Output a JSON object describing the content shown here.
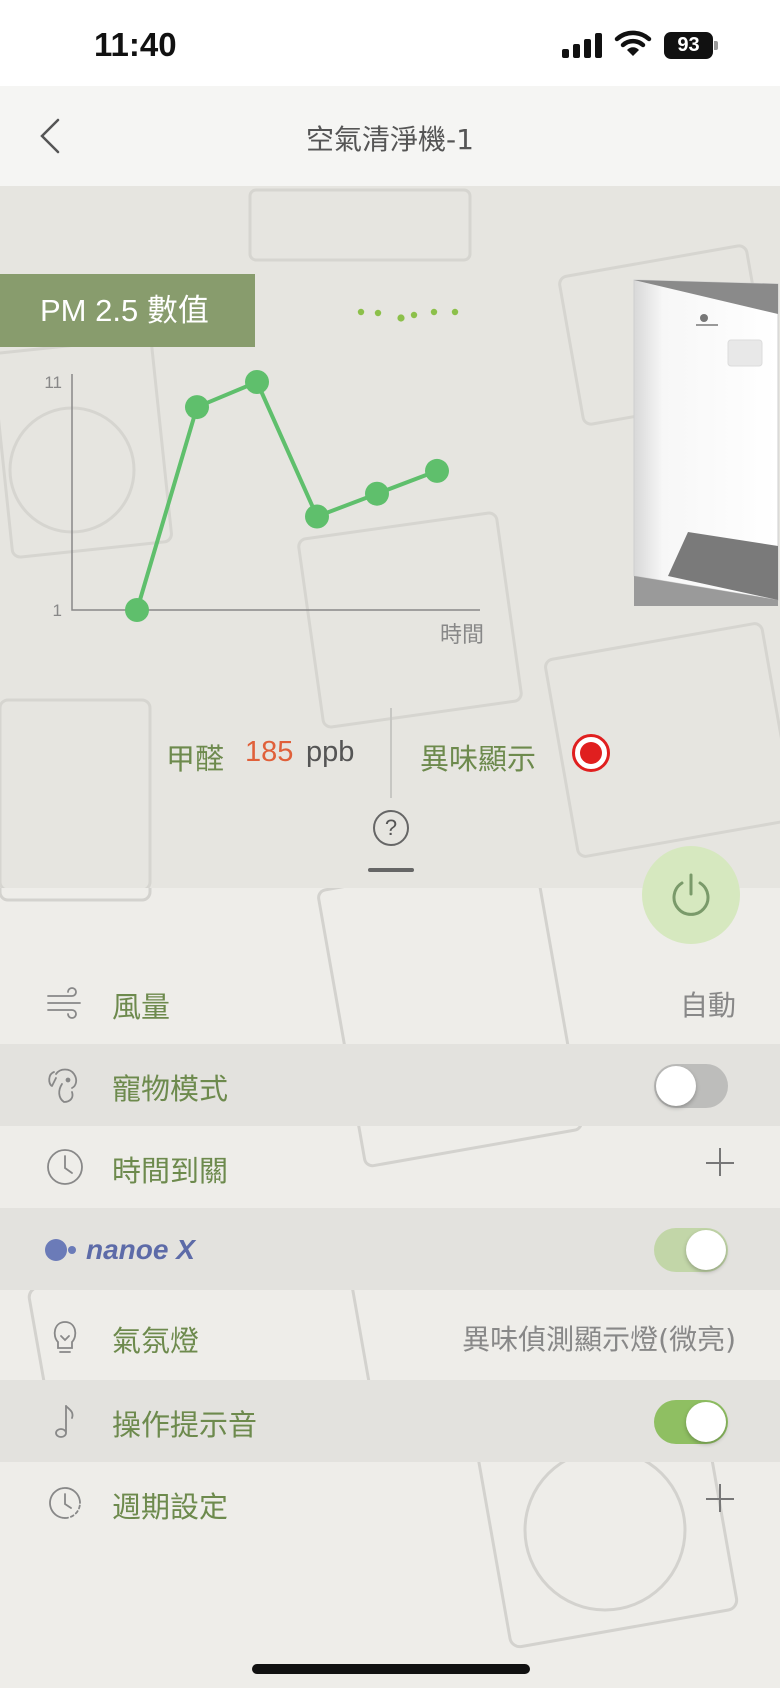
{
  "status_bar": {
    "time": "11:40",
    "battery": "93",
    "icons": [
      "signal-icon",
      "wifi-icon",
      "battery-icon"
    ]
  },
  "header": {
    "title": "空氣清淨機-1",
    "back_icon": "chevron-left-icon"
  },
  "pm_panel": {
    "title": "PM 2.5 數值",
    "loading_icon": "loading-dots-icon"
  },
  "chart_data": {
    "type": "line",
    "title": "",
    "xlabel": "時間",
    "ylabel": "",
    "ylim": [
      1,
      11
    ],
    "yticks": [
      "11",
      "1"
    ],
    "series": [
      {
        "values": [
          1,
          9.9,
          11,
          5.1,
          6.1,
          7.1
        ]
      }
    ],
    "colors": {
      "line": "#5fbf6c",
      "point": "#5fbf6c",
      "axis": "#888888"
    },
    "grid": false
  },
  "readings": {
    "formaldehyde_label": "甲醛",
    "formaldehyde_value": "185",
    "formaldehyde_unit": "ppb",
    "odor_label": "異味顯示",
    "odor_status_color": "#e01f1f",
    "help_symbol": "?"
  },
  "power": {
    "icon": "power-icon",
    "color": "#7a9a6a"
  },
  "settings": {
    "fan": {
      "label": "風量",
      "value": "自動",
      "icon": "wind-icon"
    },
    "pet": {
      "label": "寵物模式",
      "icon": "pet-icon",
      "enabled": false
    },
    "timer": {
      "label": "時間到關",
      "icon": "clock-icon"
    },
    "nanoe": {
      "logo_text": "nanoe X",
      "icon": "nanoe-logo-icon",
      "enabled": true
    },
    "light": {
      "label": "氣氛燈",
      "value": "異味偵測顯示燈(微亮)",
      "icon": "bulb-icon"
    },
    "sound": {
      "label": "操作提示音",
      "icon": "music-note-icon",
      "enabled": true
    },
    "schedule": {
      "label": "週期設定",
      "icon": "schedule-clock-icon"
    }
  },
  "colors": {
    "accent_green": "#6d8a4d",
    "pm_box": "#889c6d",
    "formaldehyde_value": "#e0603a"
  }
}
